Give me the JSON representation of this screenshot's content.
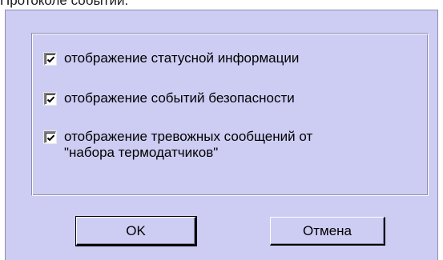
{
  "caption": "Протоколе событий.",
  "options": [
    {
      "label": "отображение статусной информации",
      "checked": true
    },
    {
      "label": "отображение событий безопасности",
      "checked": true
    },
    {
      "label": "отображение тревожных сообщений от\n\"набора термодатчиков\"",
      "checked": true
    }
  ],
  "buttons": {
    "ok_label": "OK",
    "cancel_label": "Отмена"
  },
  "colors": {
    "dialog_background": "#cdcdf4",
    "check_mark": "#000000"
  },
  "icons": {
    "check": "check-mark-icon"
  }
}
